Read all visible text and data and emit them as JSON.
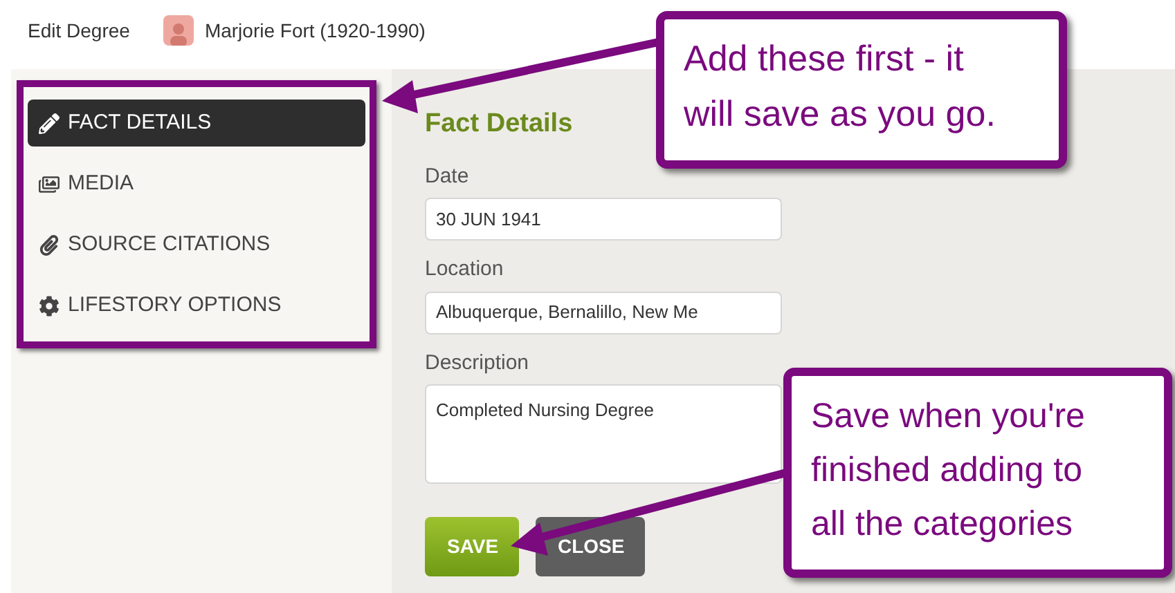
{
  "header": {
    "title": "Edit Degree",
    "person": "Marjorie Fort (1920-1990)"
  },
  "sidebar": {
    "items": [
      {
        "label": "FACT DETAILS",
        "kind": "pencil",
        "selected": true
      },
      {
        "label": "MEDIA",
        "kind": "photos",
        "selected": false
      },
      {
        "label": "SOURCE CITATIONS",
        "kind": "paperclip",
        "selected": false
      },
      {
        "label": "LIFESTORY OPTIONS",
        "kind": "gear",
        "selected": false
      }
    ]
  },
  "form": {
    "heading": "Fact Details",
    "fields": [
      {
        "label": "Date",
        "value": "30 JUN 1941",
        "kind": "line"
      },
      {
        "label": "Location",
        "value": "Albuquerque, Bernalillo, New Me",
        "kind": "line"
      },
      {
        "label": "Description",
        "value": "Completed Nursing Degree",
        "kind": "area"
      }
    ],
    "buttons": [
      {
        "label": "SAVE",
        "kind": "primary"
      },
      {
        "label": "CLOSE",
        "kind": "secondary"
      }
    ]
  },
  "callouts": [
    "Add these first - it will save as you go.",
    "Save when you're finished adding to all the categories"
  ]
}
